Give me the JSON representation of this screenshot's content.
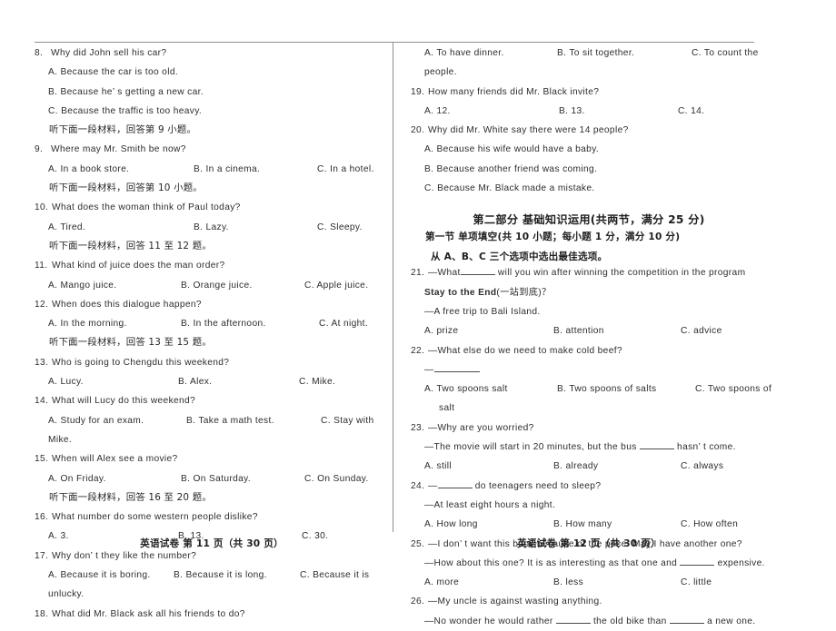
{
  "document": {
    "title": "英语试卷",
    "footer_left": "英语试卷  第 11 页（共 30 页）",
    "footer_right": "英语试卷  第 12 页（共 30 页）"
  },
  "left_page": {
    "page_label": "第 11 页",
    "blocks": [
      {
        "kind": "question",
        "number": "8.",
        "stem": "Why did John sell his car?",
        "options_stacked": [
          "A. Because the car is too old.",
          "B. Because he’ s getting a new car.",
          "C. Because the traffic is too heavy."
        ]
      },
      {
        "kind": "direction",
        "text": "听下面一段材料，回答第 9 小题。"
      },
      {
        "kind": "question",
        "number": "9.",
        "stem": "Where may Mr. Smith be now?",
        "options_inline": [
          "A. In a book store.",
          "B. In a cinema.",
          "C. In a hotel."
        ]
      },
      {
        "kind": "direction",
        "text": "听下面一段材料，回答第 10 小题。"
      },
      {
        "kind": "question",
        "number": "10.",
        "stem": "What does the woman think of Paul today?",
        "options_inline": [
          "A. Tired.",
          "B. Lazy.",
          "C. Sleepy."
        ]
      },
      {
        "kind": "direction",
        "text": "听下面一段材料，回答 11 至 12 题。"
      },
      {
        "kind": "question",
        "number": "11.",
        "stem": "What kind of juice does the man order?",
        "options_inline": [
          "A. Mango juice.",
          "B. Orange juice.",
          "C. Apple juice."
        ]
      },
      {
        "kind": "question",
        "number": "12.",
        "stem": "When does this dialogue happen?",
        "options_inline": [
          "A. In the morning.",
          "B. In the afternoon.",
          "C. At night."
        ]
      },
      {
        "kind": "direction",
        "text": "听下面一段材料，回答 13 至 15 题。"
      },
      {
        "kind": "question",
        "number": "13.",
        "stem": "Who is going to Chengdu this weekend?",
        "options_inline": [
          "A. Lucy.",
          "B. Alex.",
          "C. Mike."
        ]
      },
      {
        "kind": "question",
        "number": "14.",
        "stem": "What will Lucy do this weekend?",
        "options_inline": [
          "A. Study for an exam.",
          "B. Take a math test.",
          "C. Stay with"
        ],
        "wrap": "Mike."
      },
      {
        "kind": "question",
        "number": "15.",
        "stem": "When will Alex see a movie?",
        "options_inline": [
          "A. On Friday.",
          "B. On Saturday.",
          "C. On Sunday."
        ]
      },
      {
        "kind": "direction",
        "text": "听下面一段材料，回答 16 至 20 题。"
      },
      {
        "kind": "question",
        "number": "16.",
        "stem": "What number do some western people dislike?",
        "options_inline": [
          "A. 3.",
          "B. 13.",
          "C. 30."
        ]
      },
      {
        "kind": "question",
        "number": "17.",
        "stem": "Why don’ t they like the number?",
        "options_inline": [
          "A. Because it is boring.",
          "B. Because it is long.",
          "C. Because it is"
        ],
        "wrap": "unlucky."
      },
      {
        "kind": "question",
        "number": "18.",
        "stem": "What did Mr. Black ask all his friends to do?"
      }
    ]
  },
  "right_page": {
    "page_label": "第 12 页",
    "q18_options": [
      "A. To have dinner.",
      "B. To sit together.",
      "C. To count the"
    ],
    "q18_wrap": "people.",
    "blocks": [
      {
        "kind": "question",
        "number": "19.",
        "stem": "How many friends did Mr. Black invite?",
        "options_inline": [
          "A. 12.",
          "B. 13.",
          "C. 14."
        ]
      },
      {
        "kind": "question",
        "number": "20.",
        "stem": "Why did Mr. White say there were 14 people?",
        "options_stacked": [
          "A. Because his wife would have a baby.",
          "B. Because another friend was coming.",
          "C. Because Mr. Black made a mistake."
        ]
      }
    ],
    "part_two": {
      "heading": "第二部分  基础知识运用(共两节，满分 25 分)",
      "section_heading": "第一节  单项填空(共 10 小题；每小题 1 分，满分 10 分)",
      "instruction": "从 A、B、C 三个选项中选出最佳选项。"
    },
    "mcq": [
      {
        "number": "21.",
        "stem_a": "—What",
        "stem_b": "will you win after winning the competition in the program",
        "stem_line2_bold": "Stay to the End",
        "stem_line2_rest": "(一站到底)？",
        "answer_line": "—A free trip to Bali Island.",
        "options": [
          "A. prize",
          "B. attention",
          "C. advice"
        ]
      },
      {
        "number": "22.",
        "stem_a": "—What else do we need to make cold beef?",
        "answer_line": "—",
        "options": [
          "A. Two spoons salt",
          "B. Two spoons of salts",
          "C. Two spoons of"
        ],
        "wrap": "salt"
      },
      {
        "number": "23.",
        "stem_a": "—Why are you worried?",
        "answer_pre": "—The movie will start in 20 minutes, but the bus",
        "answer_post": "hasn’ t come.",
        "options": [
          "A. still",
          "B. already",
          "C. always"
        ]
      },
      {
        "number": "24.",
        "stem_pre": "—",
        "stem_post": "do teenagers need to sleep?",
        "answer_line": "—At least eight hours a night.",
        "options": [
          "A. How long",
          "B. How many",
          "C. How often"
        ]
      },
      {
        "number": "25.",
        "stem_a": "—I don’ t want this book because of the price. May I have another one?",
        "answer_pre": "—How about this one? It is as interesting as that one and",
        "answer_post": "expensive.",
        "options": [
          "A. more",
          "B. less",
          "C. little"
        ]
      },
      {
        "number": "26.",
        "stem_a": "—My uncle is against wasting anything.",
        "answer_pre": "—No wonder he would rather",
        "answer_mid": "the old bike than",
        "answer_post": "a new one."
      }
    ]
  }
}
